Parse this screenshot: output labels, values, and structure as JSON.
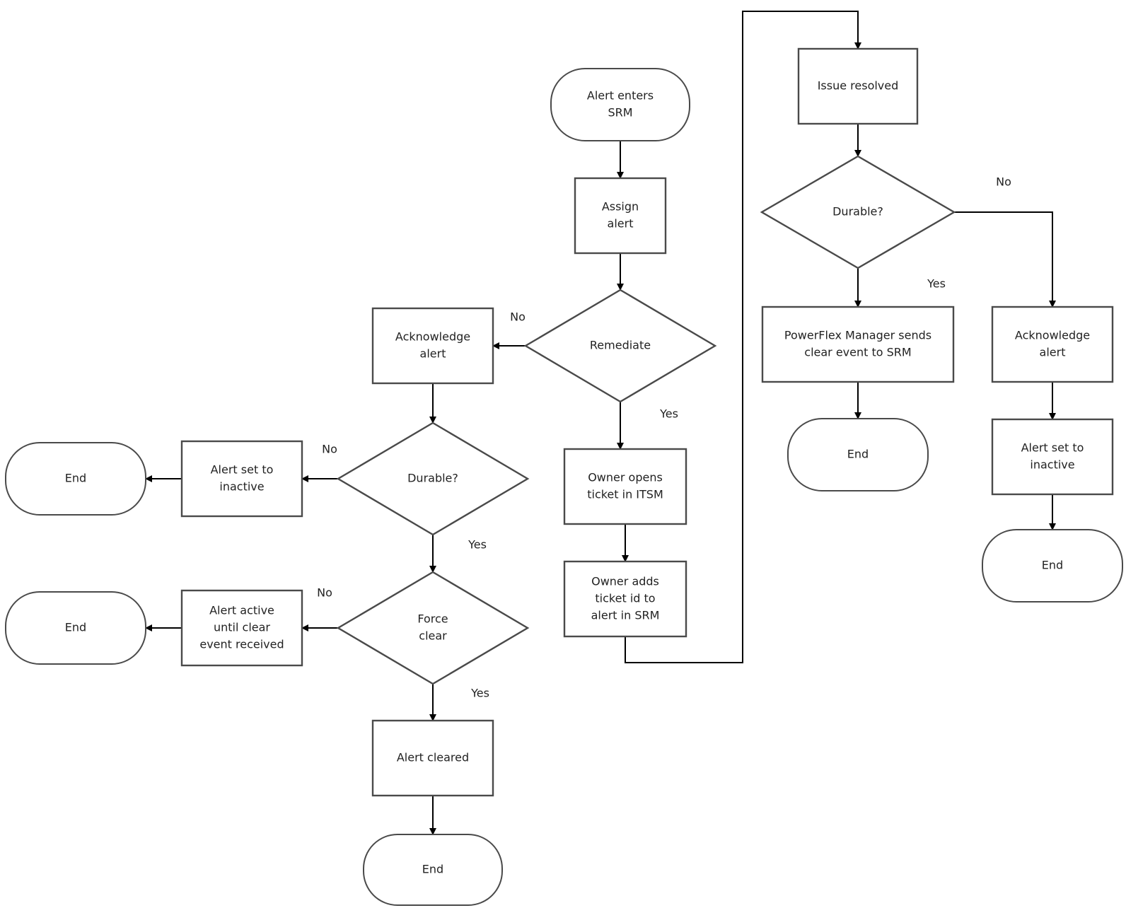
{
  "diagram": {
    "type": "flowchart",
    "nodes": {
      "start": {
        "shape": "terminal",
        "lines": [
          "Alert enters",
          "SRM"
        ]
      },
      "assign": {
        "shape": "process",
        "lines": [
          "Assign",
          "alert"
        ]
      },
      "remediate": {
        "shape": "decision",
        "lines": [
          "Remediate"
        ]
      },
      "ack_left": {
        "shape": "process",
        "lines": [
          "Acknowledge",
          "alert"
        ]
      },
      "durable_left": {
        "shape": "decision",
        "lines": [
          "Durable?"
        ]
      },
      "inactive_left": {
        "shape": "process",
        "lines": [
          "Alert set to",
          "inactive"
        ]
      },
      "end_1": {
        "shape": "terminal",
        "lines": [
          "End"
        ]
      },
      "force_clear": {
        "shape": "decision",
        "lines": [
          "Force",
          "clear"
        ]
      },
      "active_until": {
        "shape": "process",
        "lines": [
          "Alert active",
          "until clear",
          "event received"
        ]
      },
      "end_2": {
        "shape": "terminal",
        "lines": [
          "End"
        ]
      },
      "cleared": {
        "shape": "process",
        "lines": [
          "Alert cleared"
        ]
      },
      "end_3": {
        "shape": "terminal",
        "lines": [
          "End"
        ]
      },
      "open_ticket": {
        "shape": "process",
        "lines": [
          "Owner opens",
          "ticket in ITSM"
        ]
      },
      "add_ticket": {
        "shape": "process",
        "lines": [
          "Owner adds",
          "ticket id to",
          "alert in SRM"
        ]
      },
      "resolved": {
        "shape": "process",
        "lines": [
          "Issue resolved"
        ]
      },
      "durable_right": {
        "shape": "decision",
        "lines": [
          "Durable?"
        ]
      },
      "pfm_clear": {
        "shape": "process",
        "lines": [
          "PowerFlex Manager sends",
          "clear event to SRM"
        ]
      },
      "end_4": {
        "shape": "terminal",
        "lines": [
          "End"
        ]
      },
      "ack_right": {
        "shape": "process",
        "lines": [
          "Acknowledge",
          "alert"
        ]
      },
      "inactive_right": {
        "shape": "process",
        "lines": [
          "Alert set to",
          "inactive"
        ]
      },
      "end_5": {
        "shape": "terminal",
        "lines": [
          "End"
        ]
      }
    },
    "edges": [
      {
        "from": "start",
        "to": "assign",
        "label": ""
      },
      {
        "from": "assign",
        "to": "remediate",
        "label": ""
      },
      {
        "from": "remediate",
        "to": "ack_left",
        "label": "No"
      },
      {
        "from": "remediate",
        "to": "open_ticket",
        "label": "Yes"
      },
      {
        "from": "ack_left",
        "to": "durable_left",
        "label": ""
      },
      {
        "from": "durable_left",
        "to": "inactive_left",
        "label": "No"
      },
      {
        "from": "inactive_left",
        "to": "end_1",
        "label": ""
      },
      {
        "from": "durable_left",
        "to": "force_clear",
        "label": "Yes"
      },
      {
        "from": "force_clear",
        "to": "active_until",
        "label": "No"
      },
      {
        "from": "active_until",
        "to": "end_2",
        "label": ""
      },
      {
        "from": "force_clear",
        "to": "cleared",
        "label": "Yes"
      },
      {
        "from": "cleared",
        "to": "end_3",
        "label": ""
      },
      {
        "from": "open_ticket",
        "to": "add_ticket",
        "label": ""
      },
      {
        "from": "add_ticket",
        "to": "resolved",
        "label": ""
      },
      {
        "from": "resolved",
        "to": "durable_right",
        "label": ""
      },
      {
        "from": "durable_right",
        "to": "pfm_clear",
        "label": "Yes"
      },
      {
        "from": "durable_right",
        "to": "ack_right",
        "label": "No"
      },
      {
        "from": "pfm_clear",
        "to": "end_4",
        "label": ""
      },
      {
        "from": "ack_right",
        "to": "inactive_right",
        "label": ""
      },
      {
        "from": "inactive_right",
        "to": "end_5",
        "label": ""
      }
    ]
  }
}
